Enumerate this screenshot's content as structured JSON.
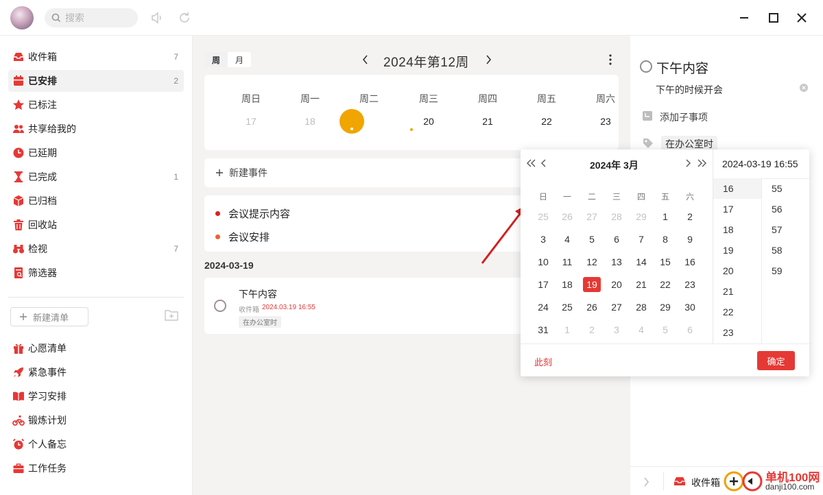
{
  "top": {
    "search_placeholder": "搜索"
  },
  "colors": {
    "accent": "#e53935",
    "today": "#f0a500",
    "bg_middle": "#f5f3f2"
  },
  "sidebar": {
    "items": [
      {
        "label": "收件箱",
        "count": "7",
        "icon": "inbox-icon"
      },
      {
        "label": "已安排",
        "count": "2",
        "icon": "calendar-icon"
      },
      {
        "label": "已标注",
        "count": "",
        "icon": "star-icon"
      },
      {
        "label": "共享给我的",
        "count": "",
        "icon": "people-icon"
      },
      {
        "label": "已延期",
        "count": "",
        "icon": "clock-icon"
      },
      {
        "label": "已完成",
        "count": "1",
        "icon": "hourglass-icon"
      },
      {
        "label": "已归档",
        "count": "",
        "icon": "archive-box-icon"
      },
      {
        "label": "回收站",
        "count": "",
        "icon": "trash-icon"
      },
      {
        "label": "检视",
        "count": "7",
        "icon": "binoculars-icon"
      },
      {
        "label": "筛选器",
        "count": "",
        "icon": "filter-doc-icon"
      }
    ],
    "new_list_label": "新建清单",
    "lists": [
      {
        "label": "心愿清单",
        "icon": "gift-icon"
      },
      {
        "label": "紧急事件",
        "icon": "rocket-icon"
      },
      {
        "label": "学习安排",
        "icon": "book-icon"
      },
      {
        "label": "锻炼计划",
        "icon": "bike-icon"
      },
      {
        "label": "个人备忘",
        "icon": "alarm-icon"
      },
      {
        "label": "工作任务",
        "icon": "briefcase-icon"
      }
    ]
  },
  "calendar": {
    "view_week": "周",
    "view_month": "月",
    "title": "2024年第12周",
    "days": [
      {
        "name": "周日",
        "date": "17"
      },
      {
        "name": "周一",
        "date": "18"
      },
      {
        "name": "周二",
        "date": "19"
      },
      {
        "name": "周三",
        "date": "20"
      },
      {
        "name": "周四",
        "date": "21"
      },
      {
        "name": "周五",
        "date": "22"
      },
      {
        "name": "周六",
        "date": "23"
      }
    ],
    "new_event": "新建事件",
    "events": [
      {
        "label": "会议提示内容",
        "color": "#e02020"
      },
      {
        "label": "会议安排",
        "color": "#f06030"
      }
    ],
    "date_heading": "2024-03-19",
    "task": {
      "title": "下午内容",
      "list": "收件箱",
      "time": "2024.03.19 16:55",
      "tag": "在办公室时"
    }
  },
  "detail": {
    "title": "下午内容",
    "note": "下午的时候开会",
    "add_subtask": "添加子事项",
    "tag": "在办公室时",
    "bottom_list": "收件箱"
  },
  "picker": {
    "month_label": "2024年 3月",
    "weekdays": [
      "日",
      "一",
      "二",
      "三",
      "四",
      "五",
      "六"
    ],
    "weeks": [
      [
        "25",
        "26",
        "27",
        "28",
        "29",
        "1",
        "2"
      ],
      [
        "3",
        "4",
        "5",
        "6",
        "7",
        "8",
        "9"
      ],
      [
        "10",
        "11",
        "12",
        "13",
        "14",
        "15",
        "16"
      ],
      [
        "17",
        "18",
        "19",
        "20",
        "21",
        "22",
        "23"
      ],
      [
        "24",
        "25",
        "26",
        "27",
        "28",
        "29",
        "30"
      ],
      [
        "31",
        "1",
        "2",
        "3",
        "4",
        "5",
        "6"
      ]
    ],
    "selected_day": "19",
    "datetime": "2024-03-19 16:55",
    "hours": [
      "16",
      "17",
      "18",
      "19",
      "20",
      "21",
      "22",
      "23"
    ],
    "minutes": [
      "55",
      "56",
      "57",
      "58",
      "59"
    ],
    "now_label": "此刻",
    "ok_label": "确定"
  },
  "watermark": {
    "text": "单机100网",
    "url": "danji100.com"
  }
}
